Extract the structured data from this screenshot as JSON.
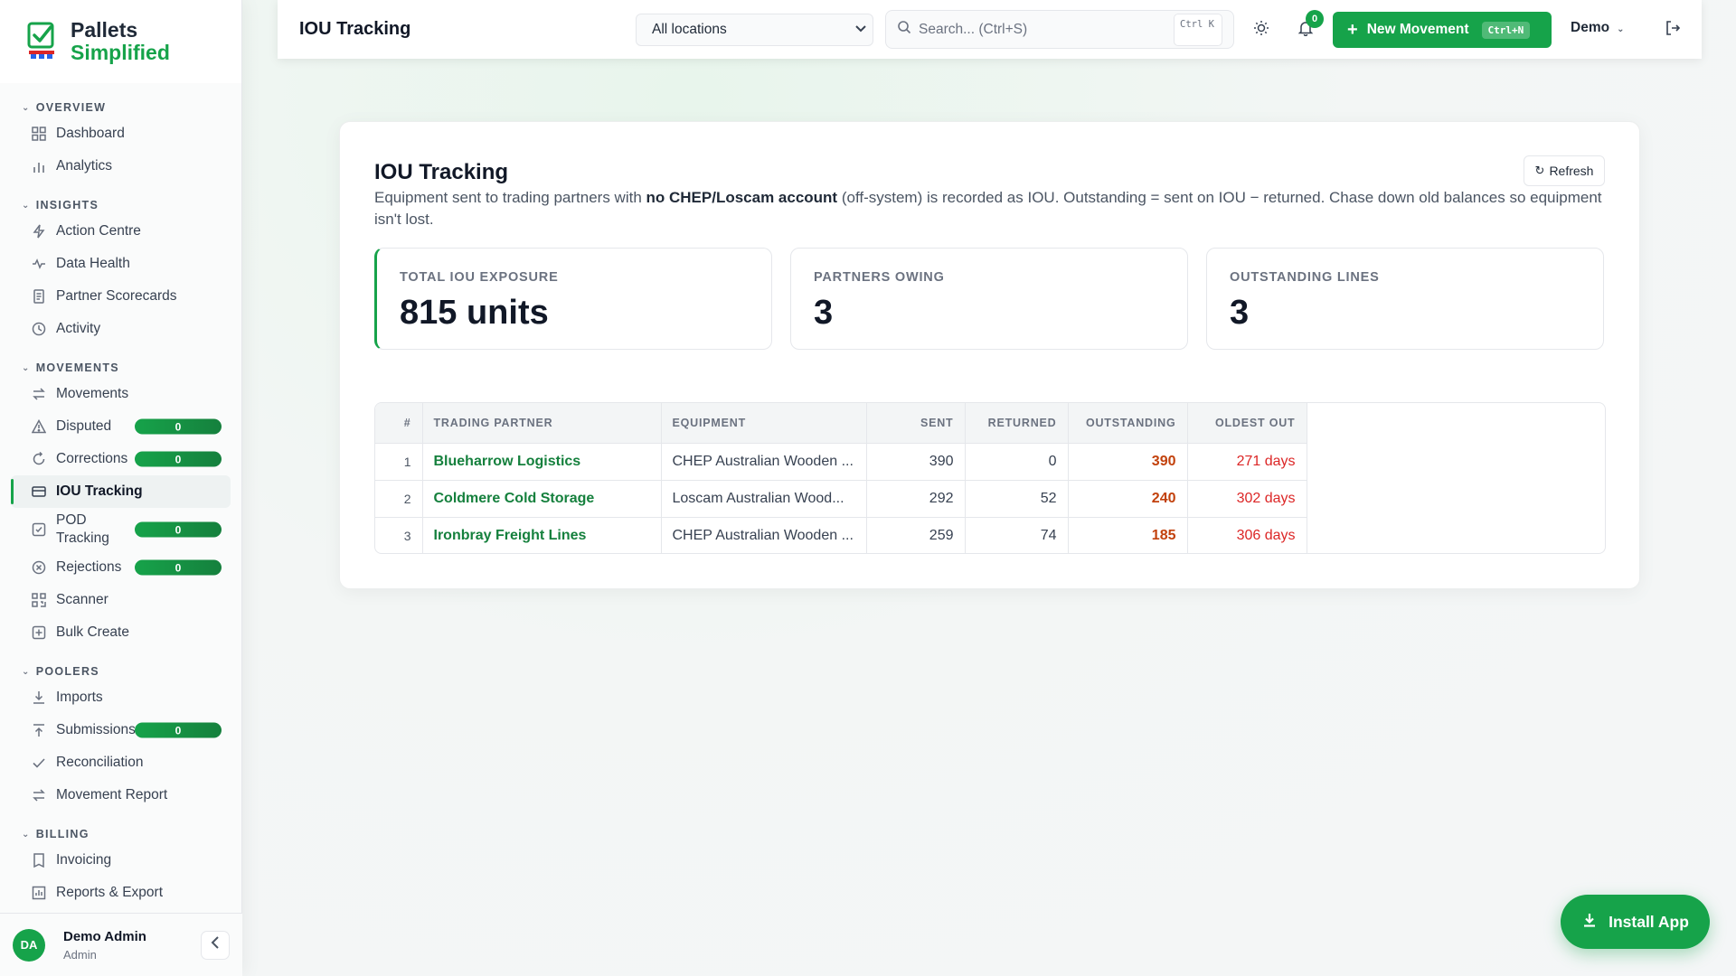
{
  "brand": {
    "line1": "Pallets",
    "line2": "Simplified"
  },
  "colors": {
    "accent": "#16a34a",
    "outstanding": "#c2410c",
    "oldest": "#dc2626"
  },
  "sidebar": {
    "sections": [
      {
        "title": "OVERVIEW",
        "items": [
          {
            "label": "Dashboard",
            "icon": "grid-icon"
          },
          {
            "label": "Analytics",
            "icon": "bar-chart-icon"
          }
        ]
      },
      {
        "title": "INSIGHTS",
        "items": [
          {
            "label": "Action Centre",
            "icon": "bolt-icon"
          },
          {
            "label": "Data Health",
            "icon": "pulse-icon"
          },
          {
            "label": "Partner Scorecards",
            "icon": "document-icon"
          },
          {
            "label": "Activity",
            "icon": "clock-icon"
          }
        ]
      },
      {
        "title": "MOVEMENTS",
        "items": [
          {
            "label": "Movements",
            "icon": "arrows-icon"
          },
          {
            "label": "Disputed",
            "icon": "warning-icon",
            "badge": "0"
          },
          {
            "label": "Corrections",
            "icon": "refresh-icon",
            "badge": "0"
          },
          {
            "label": "IOU Tracking",
            "icon": "card-icon",
            "active": true
          },
          {
            "label": "POD Tracking",
            "icon": "checkbox-icon",
            "badge": "0"
          },
          {
            "label": "Rejections",
            "icon": "x-circle-icon",
            "badge": "0"
          },
          {
            "label": "Scanner",
            "icon": "qr-icon"
          },
          {
            "label": "Bulk Create",
            "icon": "plus-square-icon"
          }
        ]
      },
      {
        "title": "POOLERS",
        "items": [
          {
            "label": "Imports",
            "icon": "download-icon"
          },
          {
            "label": "Submissions",
            "icon": "upload-icon",
            "badge": "0"
          },
          {
            "label": "Reconciliation",
            "icon": "check-icon"
          },
          {
            "label": "Movement Report",
            "icon": "arrows-icon"
          }
        ]
      },
      {
        "title": "BILLING",
        "items": [
          {
            "label": "Invoicing",
            "icon": "receipt-icon"
          },
          {
            "label": "Reports & Export",
            "icon": "chart-icon"
          }
        ]
      }
    ],
    "user": {
      "initials": "DA",
      "name": "Demo Admin",
      "role": "Admin"
    }
  },
  "topbar": {
    "title": "IOU Tracking",
    "location": "All locations",
    "search_placeholder": "Search... (Ctrl+S)",
    "search_kbd": "Ctrl K",
    "notifications": "0",
    "new_label": "New Movement",
    "new_kbd": "Ctrl+N",
    "user_menu": "Demo"
  },
  "main": {
    "title": "IOU Tracking",
    "desc_1": "Equipment sent to trading partners with ",
    "desc_bold": "no CHEP/Loscam account",
    "desc_2": " (off-system) is recorded as IOU. Outstanding = sent on IOU − returned. Chase down old balances so equipment isn't lost.",
    "refresh_label": "Refresh",
    "kpis": [
      {
        "label": "TOTAL IOU EXPOSURE",
        "value": "815 units"
      },
      {
        "label": "PARTNERS OWING",
        "value": "3"
      },
      {
        "label": "OUTSTANDING LINES",
        "value": "3"
      }
    ],
    "table": {
      "columns": [
        "#",
        "TRADING PARTNER",
        "EQUIPMENT",
        "SENT",
        "RETURNED",
        "OUTSTANDING",
        "OLDEST OUT"
      ],
      "rows": [
        {
          "n": "1",
          "partner": "Blueharrow Logistics",
          "equipment": "CHEP Australian Wooden ...",
          "sent": "390",
          "returned": "0",
          "outstanding": "390",
          "oldest": "271 days"
        },
        {
          "n": "2",
          "partner": "Coldmere Cold Storage",
          "equipment": "Loscam Australian Wood...",
          "sent": "292",
          "returned": "52",
          "outstanding": "240",
          "oldest": "302 days"
        },
        {
          "n": "3",
          "partner": "Ironbray Freight Lines",
          "equipment": "CHEP Australian Wooden ...",
          "sent": "259",
          "returned": "74",
          "outstanding": "185",
          "oldest": "306 days"
        }
      ]
    }
  },
  "install_label": "Install App"
}
